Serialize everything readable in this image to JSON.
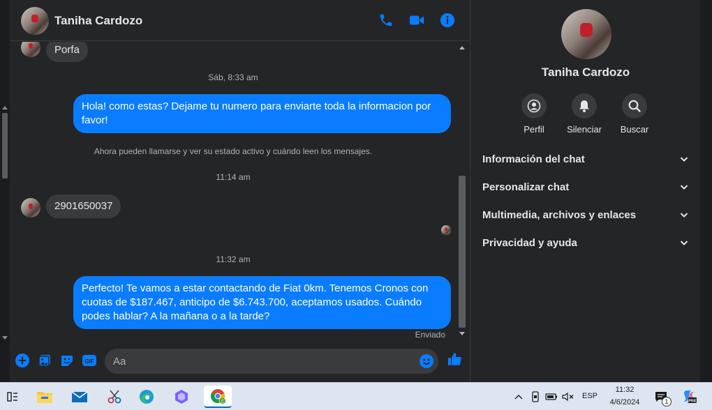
{
  "chat": {
    "contact_name": "Taniha Cardozo",
    "messages": [
      {
        "type": "incoming",
        "text": "Porfa"
      },
      {
        "type": "timestamp",
        "text": "Sáb, 8:33 am"
      },
      {
        "type": "outgoing",
        "text": "Hola! como estas? Dejame tu numero para enviarte toda la informacion por favor!"
      },
      {
        "type": "system",
        "text": "Ahora pueden llamarse y ver su estado activo y cuándo leen los mensajes."
      },
      {
        "type": "timestamp",
        "text": "11:14 am"
      },
      {
        "type": "incoming",
        "text": "2901650037"
      },
      {
        "type": "timestamp",
        "text": "11:32 am"
      },
      {
        "type": "outgoing",
        "text": "Perfecto! Te vamos a estar contactando de Fiat 0km. Tenemos Cronos con cuotas de $187.467, anticipo de $6.743.700, aceptamos usados. Cuándo podes hablar? A la mañana o a la tarde?"
      }
    ],
    "sent_status": "Enviado",
    "composer_placeholder": "Aa"
  },
  "info_panel": {
    "name": "Taniha Cardozo",
    "actions": [
      {
        "label": "Perfil",
        "icon": "profile-icon"
      },
      {
        "label": "Silenciar",
        "icon": "bell-icon"
      },
      {
        "label": "Buscar",
        "icon": "search-icon"
      }
    ],
    "sections": [
      {
        "title": "Información del chat"
      },
      {
        "title": "Personalizar chat"
      },
      {
        "title": "Multimedia, archivos y enlaces"
      },
      {
        "title": "Privacidad y ayuda"
      }
    ]
  },
  "taskbar": {
    "language": "ESP",
    "time": "11:32",
    "date": "4/6/2024",
    "notification_count": "1"
  },
  "colors": {
    "accent": "#0a7cff",
    "background": "#242526",
    "bubble_incoming": "#3a3b3c"
  }
}
